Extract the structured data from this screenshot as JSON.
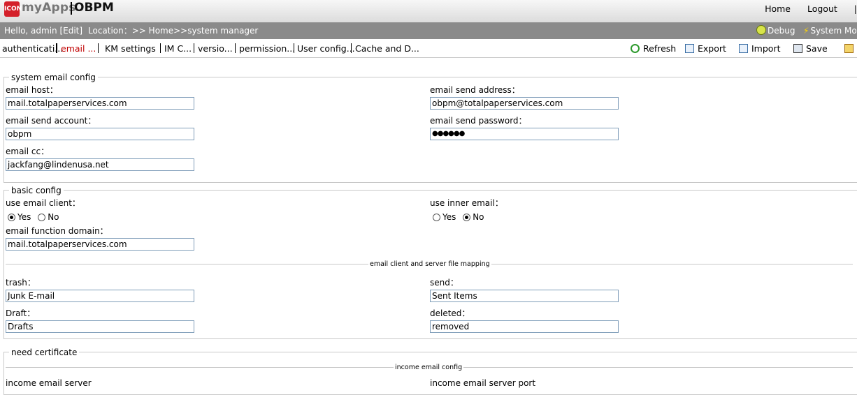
{
  "app": {
    "logo_text": "ICON",
    "brand": "myApps",
    "product": "OBPM"
  },
  "top_links": [
    "Home",
    "Logout",
    "|"
  ],
  "userbar": {
    "hello": "Hello, admin [Edit]",
    "location": "Location：>> Home>>system manager",
    "debug": "Debug",
    "system_monitor": "System Mon"
  },
  "tabs": [
    "authenticati...",
    "email ...",
    "KM settings",
    "IM C...",
    "versio...",
    "permission...",
    "User config...",
    "Cache and D..."
  ],
  "toolbar": {
    "refresh": "Refresh",
    "export": "Export",
    "import": "Import",
    "save": "Save"
  },
  "system_email_config": {
    "legend": "system email config",
    "email_host_label": "email host：",
    "email_host": "mail.totalpaperservices.com",
    "email_send_address_label": "email send address：",
    "email_send_address": "obpm@totalpaperservices.com",
    "email_send_account_label": "email send account：",
    "email_send_account": "obpm",
    "email_send_password_label": "email send password：",
    "email_send_password": "●●●●●●",
    "email_cc_label": "email cc：",
    "email_cc": "jackfang@lindenusa.net"
  },
  "basic_config": {
    "legend": "basic config",
    "use_email_client_label": "use email client：",
    "use_inner_email_label": "use inner email：",
    "yes": "Yes",
    "no": "No",
    "email_function_domain_label": "email function domain：",
    "email_function_domain": "mail.totalpaperservices.com",
    "mapping_title": "email client and server file mapping",
    "trash_label": "trash：",
    "trash": "Junk E-mail",
    "send_label": "send：",
    "send": "Sent Items",
    "draft_label": "Draft：",
    "draft": "Drafts",
    "deleted_label": "deleted：",
    "deleted": "removed"
  },
  "need_certificate": {
    "legend": "need certificate",
    "income_title": "income email config",
    "income_server_label": "income email server",
    "income_port_label": "income email server port"
  }
}
